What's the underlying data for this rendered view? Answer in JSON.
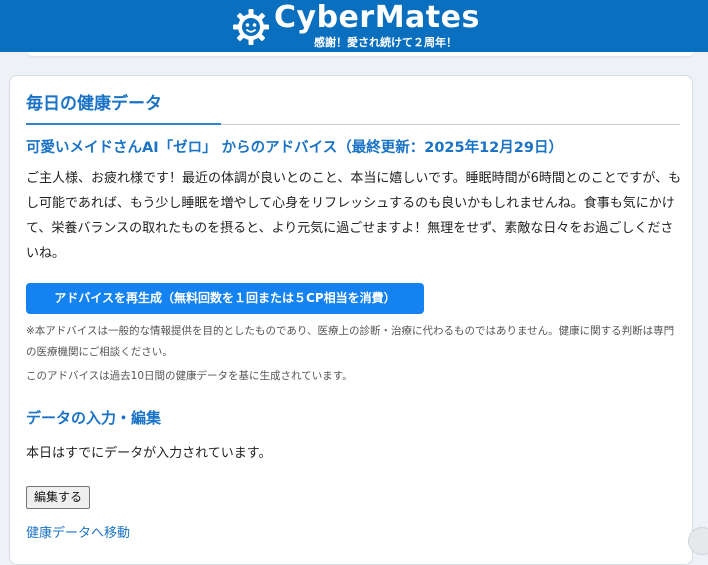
{
  "header": {
    "logo_text": "CyberMates",
    "tagline": "感謝！愛され続けて２周年！",
    "brand_color": "#0a6fbf",
    "logo_icon": "gear-face-icon"
  },
  "card": {
    "title": "毎日の健康データ",
    "advice_heading": "可愛いメイドさんAI「ゼロ」 からのアドバイス（最終更新：2025年12月29日）",
    "advice_text": "ご主人様、お疲れ様です！最近の体調が良いとのこと、本当に嬉しいです。睡眠時間が6時間とのことですが、もし可能であれば、もう少し睡眠を増やして心身をリフレッシュするのも良いかもしれませんね。食事も気にかけて、栄養バランスの取れたものを摂ると、より元気に過ごせますよ！無理をせず、素敵な日々をお過ごしくださいね。",
    "regenerate_button": "アドバイスを再生成（無料回数を１回または５CP相当を消費）",
    "disclaimer": "※本アドバイスは一般的な情報提供を目的としたものであり、医療上の診断・治療に代わるものではありません。健康に関する判断は専門の医療機関にご相談ください。",
    "basis_note": "このアドバイスは過去10日間の健康データを基に生成されています。",
    "data_section_title": "データの入力・編集",
    "entered_message": "本日はすでにデータが入力されています。",
    "edit_button": "編集する",
    "health_data_link": "健康データへ移動",
    "accent_color": "#1a73c6",
    "button_color": "#1482f0"
  }
}
